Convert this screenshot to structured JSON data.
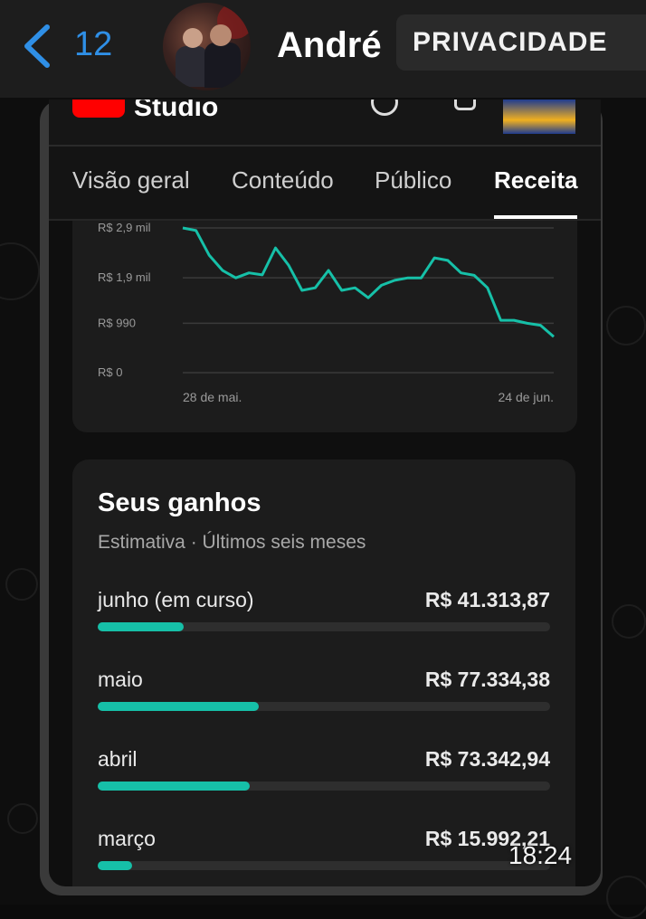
{
  "chat_header": {
    "unread_count": "12",
    "contact_name": "André",
    "privacy_button": "PRIVACIDADE"
  },
  "studio": {
    "app_title": "Studio",
    "tabs": [
      {
        "label": "Visão geral",
        "active": false
      },
      {
        "label": "Conteúdo",
        "active": false
      },
      {
        "label": "Público",
        "active": false
      },
      {
        "label": "Receita",
        "active": true
      }
    ]
  },
  "chart_data": {
    "type": "line",
    "title": "",
    "xlabel": "",
    "ylabel": "",
    "y_ticks": [
      "R$ 2,9 mil",
      "R$ 1,9 mil",
      "R$ 990",
      "R$ 0"
    ],
    "y_tick_values": [
      2900,
      1900,
      990,
      0
    ],
    "x_tick_labels": [
      "28 de mai.",
      "24 de jun."
    ],
    "ylim": [
      0,
      2900
    ],
    "grid": true,
    "color": "#16c0a8",
    "series": [
      {
        "values": [
          2900,
          2850,
          2350,
          2050,
          1900,
          2000,
          1960,
          2500,
          2150,
          1650,
          1700,
          2050,
          1650,
          1700,
          1500,
          1750,
          1850,
          1900,
          1900,
          2300,
          2250,
          2000,
          1950,
          1700,
          1050,
          1050,
          990,
          950,
          720
        ]
      }
    ]
  },
  "earnings": {
    "title": "Seus ganhos",
    "subtitle": "Estimativa · Últimos seis meses",
    "rows": [
      {
        "month": "junho (em curso)",
        "amount": "R$ 41.313,87",
        "fraction": 0.19
      },
      {
        "month": "maio",
        "amount": "R$ 77.334,38",
        "fraction": 0.355
      },
      {
        "month": "abril",
        "amount": "R$ 73.342,94",
        "fraction": 0.335
      },
      {
        "month": "março",
        "amount": "R$ 15.992,21",
        "fraction": 0.075
      }
    ]
  },
  "message_time": "18:24"
}
